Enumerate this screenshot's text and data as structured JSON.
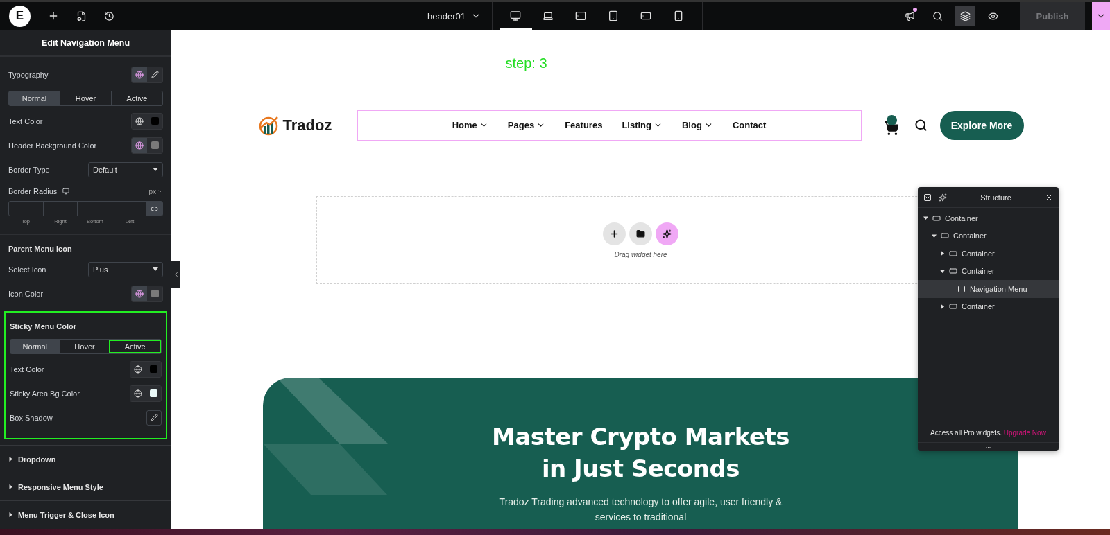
{
  "topbar": {
    "logo": "E",
    "document": "header01",
    "devices": [
      {
        "kind": "desktop",
        "selected": true
      },
      {
        "kind": "laptop",
        "selected": false
      },
      {
        "kind": "tablet-landscape",
        "selected": false
      },
      {
        "kind": "tablet",
        "selected": false
      },
      {
        "kind": "mobile-landscape",
        "selected": false
      },
      {
        "kind": "mobile",
        "selected": false
      }
    ],
    "notification": true,
    "layers_selected": true,
    "publish": {
      "label": "Publish",
      "disabled": true
    }
  },
  "panel": {
    "title": "Edit Navigation Menu",
    "groups": [
      {
        "highlighted": false,
        "controls": [
          {
            "kind": "popover",
            "label": "Typography",
            "globe_active": true
          },
          {
            "kind": "tabs",
            "tabs": [
              {
                "label": "Normal",
                "selected": true,
                "highlighted": false
              },
              {
                "label": "Hover",
                "selected": false,
                "highlighted": false
              },
              {
                "label": "Active",
                "selected": false,
                "highlighted": false
              }
            ]
          },
          {
            "kind": "color",
            "label": "Text Color",
            "globe_active": false,
            "color": "#000000"
          },
          {
            "kind": "color",
            "label": "Header Background Color",
            "globe_active": true,
            "color": "#7a7a7a"
          },
          {
            "kind": "select",
            "label": "Border Type",
            "value": "Default"
          },
          {
            "kind": "dimensions",
            "label": "Border Radius",
            "unit": "px",
            "fields": [
              "Top",
              "Right",
              "Bottom",
              "Left"
            ]
          }
        ]
      },
      {
        "highlighted": false,
        "controls": [
          {
            "kind": "heading",
            "label": "Parent Menu Icon"
          },
          {
            "kind": "select",
            "label": "Select Icon",
            "value": "Plus"
          },
          {
            "kind": "color",
            "label": "Icon Color",
            "globe_active": true,
            "color": "#7a7a7a"
          }
        ]
      },
      {
        "highlighted": true,
        "controls": [
          {
            "kind": "heading",
            "label": "Sticky Menu Color"
          },
          {
            "kind": "tabs",
            "tabs": [
              {
                "label": "Normal",
                "selected": true,
                "highlighted": false
              },
              {
                "label": "Hover",
                "selected": false,
                "highlighted": false
              },
              {
                "label": "Active",
                "selected": false,
                "highlighted": true
              }
            ]
          },
          {
            "kind": "color",
            "label": "Text Color",
            "globe_active": false,
            "color": "#000000"
          },
          {
            "kind": "color",
            "label": "Sticky Area Bg Color",
            "globe_active": false,
            "color": "#eaf8f8"
          },
          {
            "kind": "edit",
            "label": "Box Shadow"
          }
        ]
      }
    ],
    "sections": [
      {
        "label": "Dropdown",
        "expanded": false
      },
      {
        "label": "Responsive Menu Style",
        "expanded": false
      },
      {
        "label": "Menu Trigger & Close Icon",
        "expanded": false
      }
    ]
  },
  "canvas": {
    "annotation": "step: 3",
    "header": {
      "logo": "Tradoz",
      "menu_selected": true,
      "menu": [
        {
          "label": "Home",
          "dropdown": true
        },
        {
          "label": "Pages",
          "dropdown": true
        },
        {
          "label": "Features",
          "dropdown": false
        },
        {
          "label": "Listing",
          "dropdown": true
        },
        {
          "label": "Blog",
          "dropdown": true
        },
        {
          "label": "Contact",
          "dropdown": false
        }
      ],
      "cta": "Explore More"
    },
    "dropzone": {
      "hint": "Drag widget here"
    },
    "hero": {
      "title_lines": [
        "Master Crypto Markets",
        "in Just Seconds"
      ],
      "subtitle_lines": [
        "Tradoz Trading advanced technology to offer agile, user friendly &",
        "services to traditional"
      ]
    }
  },
  "structure": {
    "title": "Structure",
    "tree": [
      {
        "label": "Container",
        "kind": "container",
        "expanded": true,
        "selected": false,
        "children": [
          {
            "label": "Container",
            "kind": "container",
            "expanded": true,
            "selected": false,
            "children": [
              {
                "label": "Container",
                "kind": "container",
                "expanded": false,
                "selected": false
              },
              {
                "label": "Container",
                "kind": "container",
                "expanded": true,
                "selected": false,
                "children": [
                  {
                    "label": "Navigation Menu",
                    "kind": "widget",
                    "selected": true
                  }
                ]
              },
              {
                "label": "Container",
                "kind": "container",
                "expanded": false,
                "selected": false
              }
            ]
          }
        ]
      }
    ],
    "promo": "Access all Pro widgets.",
    "promo_link": "Upgrade Now",
    "handle": "..."
  }
}
